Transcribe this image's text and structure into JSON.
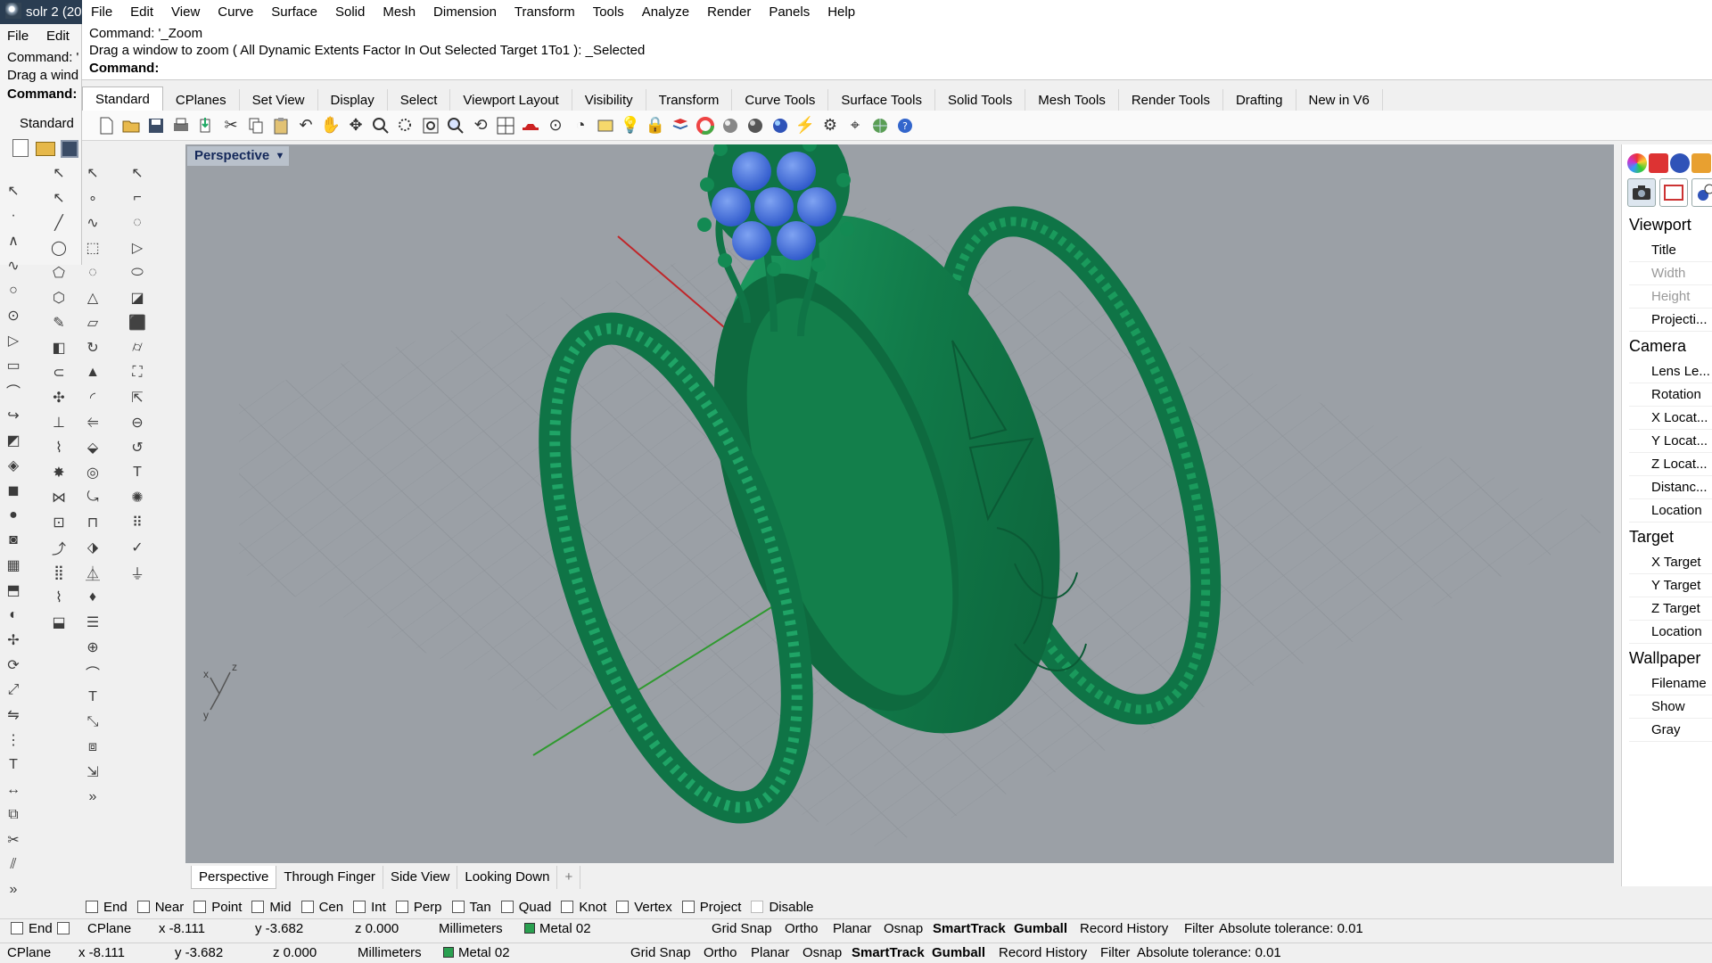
{
  "window": {
    "title": "solr 2 (20"
  },
  "menu": [
    "File",
    "Edit",
    "View",
    "Curve",
    "Surface",
    "Solid",
    "Mesh",
    "Dimension",
    "Transform",
    "Tools",
    "Analyze",
    "Render",
    "Panels",
    "Help"
  ],
  "command": {
    "history1": "Command: '_Zoom",
    "history2": "Drag a window to zoom ( All  Dynamic  Extents  Factor  In  Out  Selected  Target  1To1 ): _Selected",
    "prompt": "Command:"
  },
  "ghost_window": {
    "menu1": "File",
    "menu2": "Edit",
    "line1": "Command: '",
    "line2": "Drag a wind",
    "line3": "Command:",
    "toolbar_label": "Standard"
  },
  "toolbar_tabs": [
    "Standard",
    "CPlanes",
    "Set View",
    "Display",
    "Select",
    "Viewport Layout",
    "Visibility",
    "Transform",
    "Curve Tools",
    "Surface Tools",
    "Solid Tools",
    "Mesh Tools",
    "Render Tools",
    "Drafting",
    "New in V6"
  ],
  "viewport": {
    "title": "Perspective",
    "tabs": [
      "Perspective",
      "Through Finger",
      "Side View",
      "Looking Down"
    ],
    "add_tab": "+",
    "axis_x": "x",
    "axis_y": "y",
    "axis_z": "z"
  },
  "osnaps": [
    "End",
    "Near",
    "Point",
    "Mid",
    "Cen",
    "Int",
    "Perp",
    "Tan",
    "Quad",
    "Knot",
    "Vertex",
    "Project",
    "Disable"
  ],
  "status": {
    "cplane": "CPlane",
    "x": "x -8.111",
    "y": "y -3.682",
    "z": "z 0.000",
    "units": "Millimeters",
    "layer": "Metal 02",
    "grid_snap": "Grid Snap",
    "ortho": "Ortho",
    "planar": "Planar",
    "osnap": "Osnap",
    "smarttrack": "SmartTrack",
    "gumball": "Gumball",
    "record_history": "Record History",
    "filter": "Filter",
    "tolerance": "Absolute tolerance: 0.01",
    "ghost_end": "End"
  },
  "panel": {
    "viewport_head": "Viewport",
    "viewport_rows": [
      "Title",
      "Width",
      "Height",
      "Projecti..."
    ],
    "camera_head": "Camera",
    "camera_rows": [
      "Lens Le...",
      "Rotation",
      "X Locat...",
      "Y Locat...",
      "Z Locat...",
      "Distanc...",
      "Location"
    ],
    "target_head": "Target",
    "target_rows": [
      "X Target",
      "Y Target",
      "Z Target",
      "Location"
    ],
    "wallpaper_head": "Wallpaper",
    "wallpaper_rows": [
      "Filename",
      "Show",
      "Gray"
    ]
  },
  "colors": {
    "ring_metal": "#13804f",
    "gem": "#3f6fd8",
    "viewport_bg": "#9ba0a6",
    "x_axis": "#c0262a",
    "y_axis": "#2f9a2f"
  }
}
